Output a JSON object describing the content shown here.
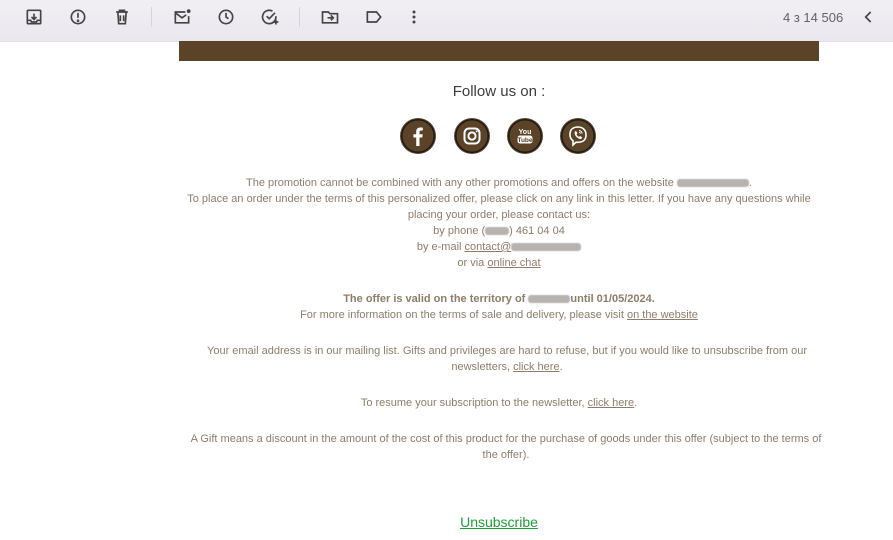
{
  "toolbar": {
    "icons": [
      "archive-icon",
      "report-spam-icon",
      "delete-icon",
      "mark-unread-icon",
      "snooze-icon",
      "add-task-icon",
      "move-to-icon",
      "label-icon",
      "more-icon"
    ],
    "pager": "4 з 14 506",
    "prev_icon": "chevron-left-icon"
  },
  "email": {
    "banner_color": "#5b4328",
    "follow_label": "Follow us on :",
    "social": [
      "facebook-icon",
      "instagram-icon",
      "youtube-icon",
      "viber-icon"
    ],
    "promo_line1_a": "The promotion cannot be combined with any other promotions and offers on the website ",
    "promo_line1_b": ".",
    "promo_line2": "To place an order under the terms of this personalized offer, please click on any link in this letter. If you have any questions while placing your order, please contact us:",
    "phone_prefix": "by phone (",
    "phone_suffix": ") 461 04 04",
    "email_prefix": "by e-mail ",
    "email_link": "contact@",
    "chat_prefix": "or via ",
    "chat_link": "online chat",
    "valid_a": "The offer is valid on the territory of ",
    "valid_b": "until 01/05/2024.",
    "more_info": "For more information on the terms of sale and delivery, please visit ",
    "more_info_link": "on the website",
    "mailing": "Your email address is in our mailing list. Gifts and privileges are hard to refuse, but if you would like to unsubscribe from our newsletters, ",
    "mailing_link": "click here",
    "mailing_end": ".",
    "resume": "To resume your subscription to the newsletter, ",
    "resume_link": "click here",
    "resume_end": ".",
    "gift": "A Gift means a discount in the amount of the cost of this product for the purchase of goods under this offer (subject to the terms of the offer).",
    "unsubscribe": "Unsubscribe",
    "unsubscribe_color": "#1e9e3a",
    "link_color": "#1a4fb5"
  }
}
